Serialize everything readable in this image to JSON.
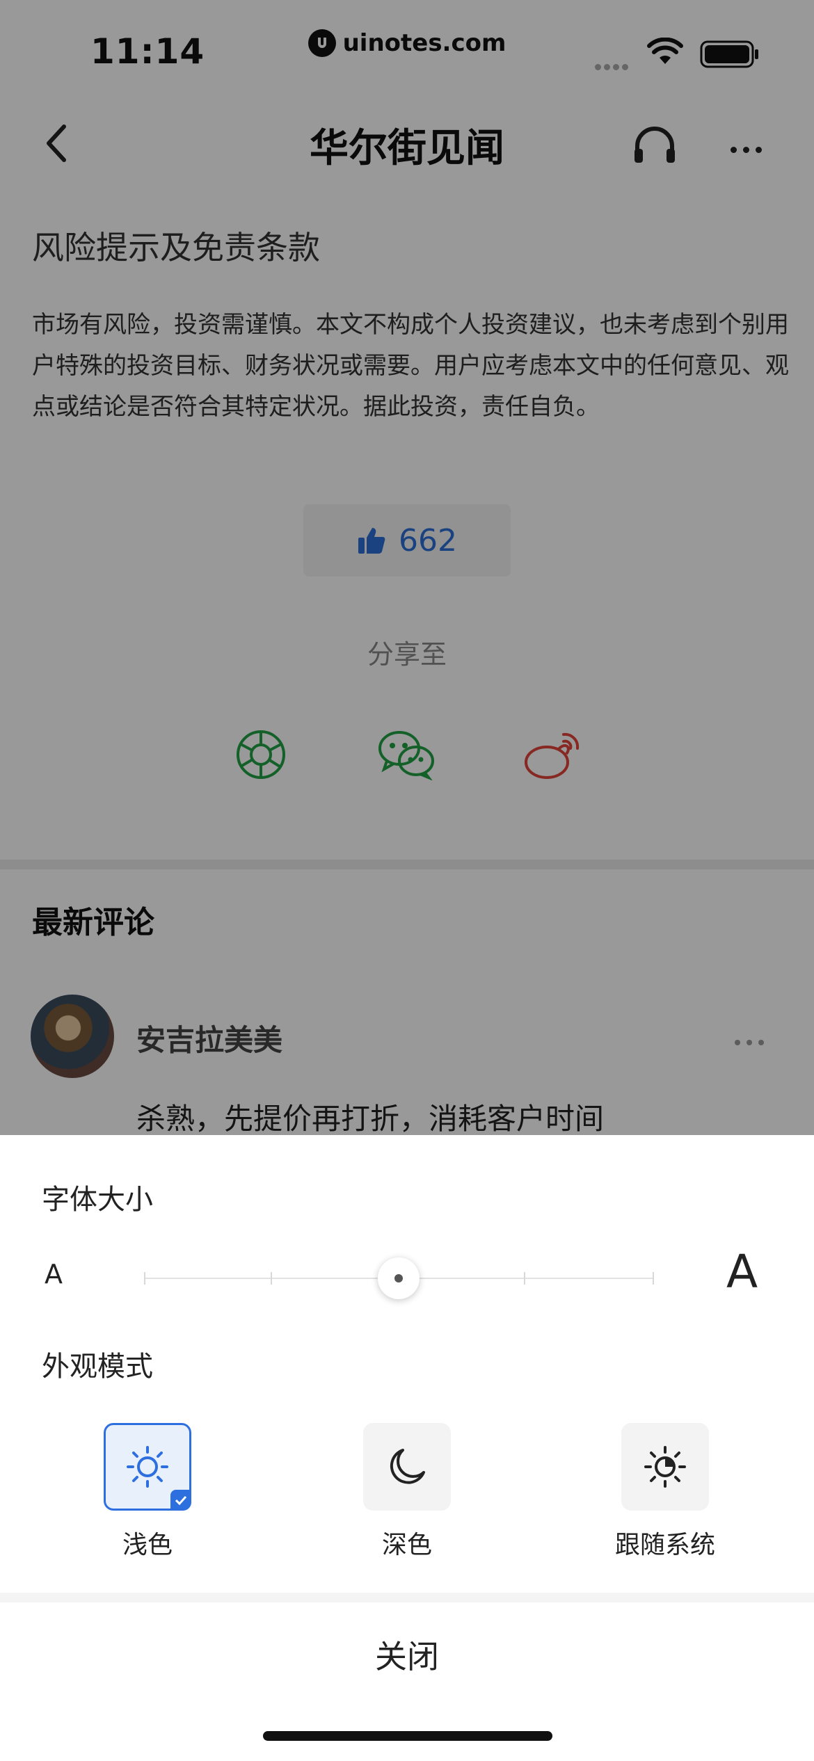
{
  "status_bar": {
    "time": "11:14",
    "watermark": "uinotes.com",
    "icons": [
      "signal-icon",
      "wifi-icon",
      "battery-icon"
    ]
  },
  "nav": {
    "title": "华尔街见闻",
    "icons": [
      "back-icon",
      "headphone-icon",
      "more-icon"
    ]
  },
  "article": {
    "risk_title": "风险提示及免责条款",
    "risk_body": "市场有风险，投资需谨慎。本文不构成个人投资建议，也未考虑到个别用户特殊的投资目标、财务状况或需要。用户应考虑本文中的任何意见、观点或结论是否符合其特定状况。据此投资，责任自负。",
    "like_count": "662",
    "share_label": "分享至",
    "share_targets": [
      "moments-icon",
      "wechat-icon",
      "weibo-icon"
    ]
  },
  "comments": {
    "title": "最新评论",
    "items": [
      {
        "user": "安吉拉美美",
        "text": "杀熟，先提价再打折，消耗客户时间"
      }
    ]
  },
  "sheet": {
    "font_size_label": "字体大小",
    "small_a": "A",
    "large_a": "A",
    "font_size_steps": 5,
    "font_size_selected_step": 3,
    "appearance_label": "外观模式",
    "modes": [
      {
        "label": "浅色",
        "icon": "sun-icon",
        "selected": true
      },
      {
        "label": "深色",
        "icon": "moon-icon",
        "selected": false
      },
      {
        "label": "跟随系统",
        "icon": "auto-theme-icon",
        "selected": false
      }
    ],
    "close_label": "关闭"
  },
  "colors": {
    "accent": "#2e6fe0",
    "like": "#2d6fd6",
    "share_green": "#22a045",
    "weibo_red": "#e2443a",
    "overlay": "rgba(0,0,0,0.40)"
  }
}
